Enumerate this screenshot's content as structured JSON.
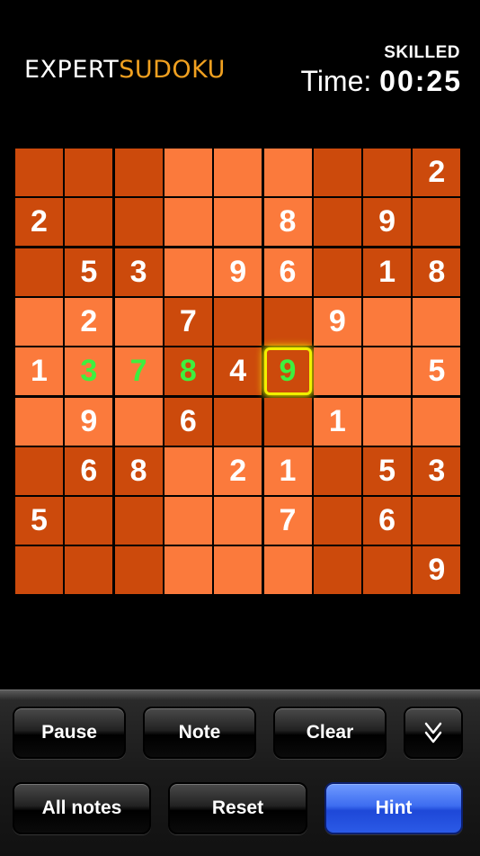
{
  "header": {
    "logo_part1": "EXPERT",
    "logo_part2": "SUDOKU",
    "difficulty": "SKILLED",
    "timer_label": "Time:",
    "timer_value": "00:25"
  },
  "board": {
    "colors": {
      "dark": "#cc4a0c",
      "light": "#fb7a3c",
      "user_digit": "#3ef03e",
      "selection": "#f2f000"
    },
    "rows": [
      [
        "",
        "",
        "",
        "",
        "",
        "",
        "",
        "",
        "2"
      ],
      [
        "2",
        "",
        "",
        "",
        "",
        "8",
        "",
        "9",
        ""
      ],
      [
        "",
        "5",
        "3",
        "",
        "9",
        "6",
        "",
        "1",
        "8"
      ],
      [
        "",
        "2",
        "",
        "7",
        "",
        "",
        "9",
        "",
        ""
      ],
      [
        "1",
        "3",
        "7",
        "8",
        "4",
        "9",
        "",
        "",
        "5"
      ],
      [
        "",
        "9",
        "",
        "6",
        "",
        "",
        "1",
        "",
        ""
      ],
      [
        "",
        "6",
        "8",
        "",
        "2",
        "1",
        "",
        "5",
        "3"
      ],
      [
        "5",
        "",
        "",
        "",
        "",
        "7",
        "",
        "6",
        ""
      ],
      [
        "",
        "",
        "",
        "",
        "",
        "",
        "",
        "",
        "9"
      ]
    ],
    "user_entries": [
      [
        4,
        1
      ],
      [
        4,
        2
      ],
      [
        4,
        3
      ],
      [
        4,
        5
      ]
    ],
    "selected_cell": [
      4,
      5
    ]
  },
  "controls": {
    "pause": "Pause",
    "note": "Note",
    "clear": "Clear",
    "collapse_icon": "double-chevron-down-icon",
    "all_notes": "All notes",
    "reset": "Reset",
    "hint": "Hint"
  }
}
